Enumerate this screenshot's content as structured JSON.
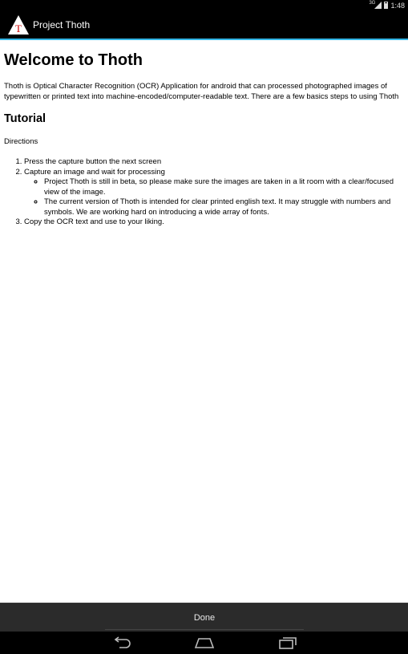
{
  "status_bar": {
    "time": "1:48",
    "network": "3G"
  },
  "app": {
    "title": "Project Thoth",
    "logo_letter": "T"
  },
  "content": {
    "heading": "Welcome to Thoth",
    "intro": "Thoth is Optical Character Recognition (OCR) Application for android that can processed photographed images of typewritten or printed text into machine-encoded/computer-readable text. There are a few basics steps to using Thoth",
    "tutorial_heading": "Tutorial",
    "directions_label": "Directions",
    "steps": [
      "Press the capture button the next screen",
      "Capture an image and wait for processing",
      "Copy the OCR text and use to your liking."
    ],
    "sub_steps": [
      "Project Thoth is still in beta, so please make sure the images are taken in a lit room with a clear/focused view of the image.",
      "The current version of Thoth is intended for clear printed english text. It may struggle with numbers and symbols. We are working hard on introducing a wide array of fonts."
    ]
  },
  "footer": {
    "done_label": "Done"
  },
  "colors": {
    "accent": "#33b5e5",
    "logo_red": "#cc0000"
  }
}
